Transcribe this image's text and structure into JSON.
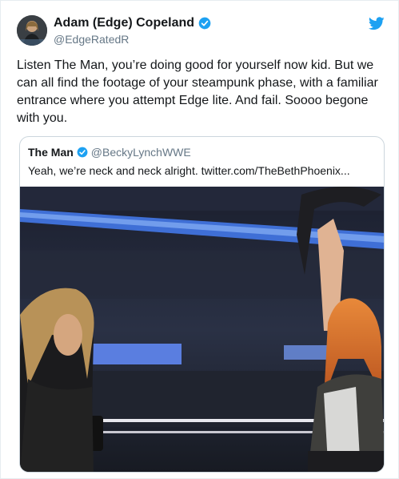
{
  "tweet": {
    "display_name": "Adam (Edge) Copeland",
    "handle": "@EdgeRatedR",
    "text": "Listen The Man, you’re doing good for yourself now kid. But we can all find the footage of your steampunk phase, with a familiar entrance where you attempt Edge lite. And fail. Soooo begone with you."
  },
  "quoted": {
    "display_name": "The Man",
    "handle": "@BeckyLynchWWE",
    "text": "Yeah, we’re neck and neck alright. twitter.com/TheBethPhoenix..."
  },
  "icons": {
    "verified": "verified-badge-icon",
    "brand": "twitter-bird-icon"
  },
  "colors": {
    "brand_blue": "#1da1f2",
    "text": "#14171a",
    "secondary_text": "#657786",
    "border": "#ccd6dd"
  }
}
